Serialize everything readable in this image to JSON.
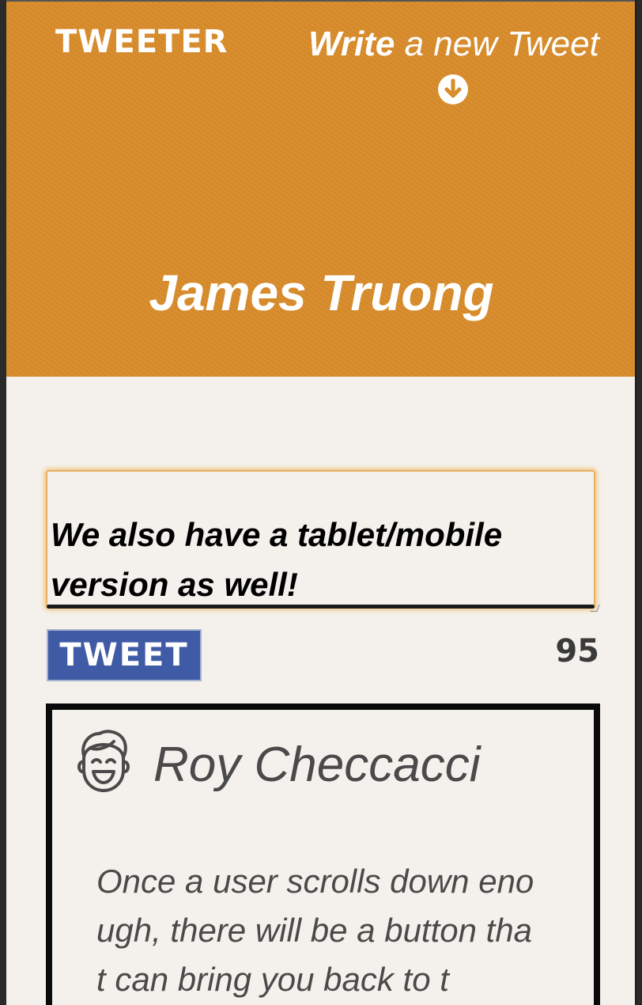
{
  "header": {
    "brand": "TWEETER",
    "compose_toggle": {
      "strong": "Write",
      "rest": " a new Tweet",
      "icon": "arrow-circle-down-icon"
    },
    "profile_name": "James Truong",
    "colors": {
      "background": "#d98c2b",
      "text": "#ffffff"
    }
  },
  "composer": {
    "input_value": "We also have a tablet/mobile version as well!",
    "tweet_button_label": "TWEET",
    "char_counter": "95",
    "colors": {
      "button": "#3f5ba6",
      "focus_glow": "#e7b161"
    }
  },
  "tweets": [
    {
      "author": "Roy Checcacci",
      "avatar_icon": "smiling-face-avatar-icon",
      "body": "Once a user scrolls down enough, there will be a button that can bring you back to t"
    }
  ]
}
